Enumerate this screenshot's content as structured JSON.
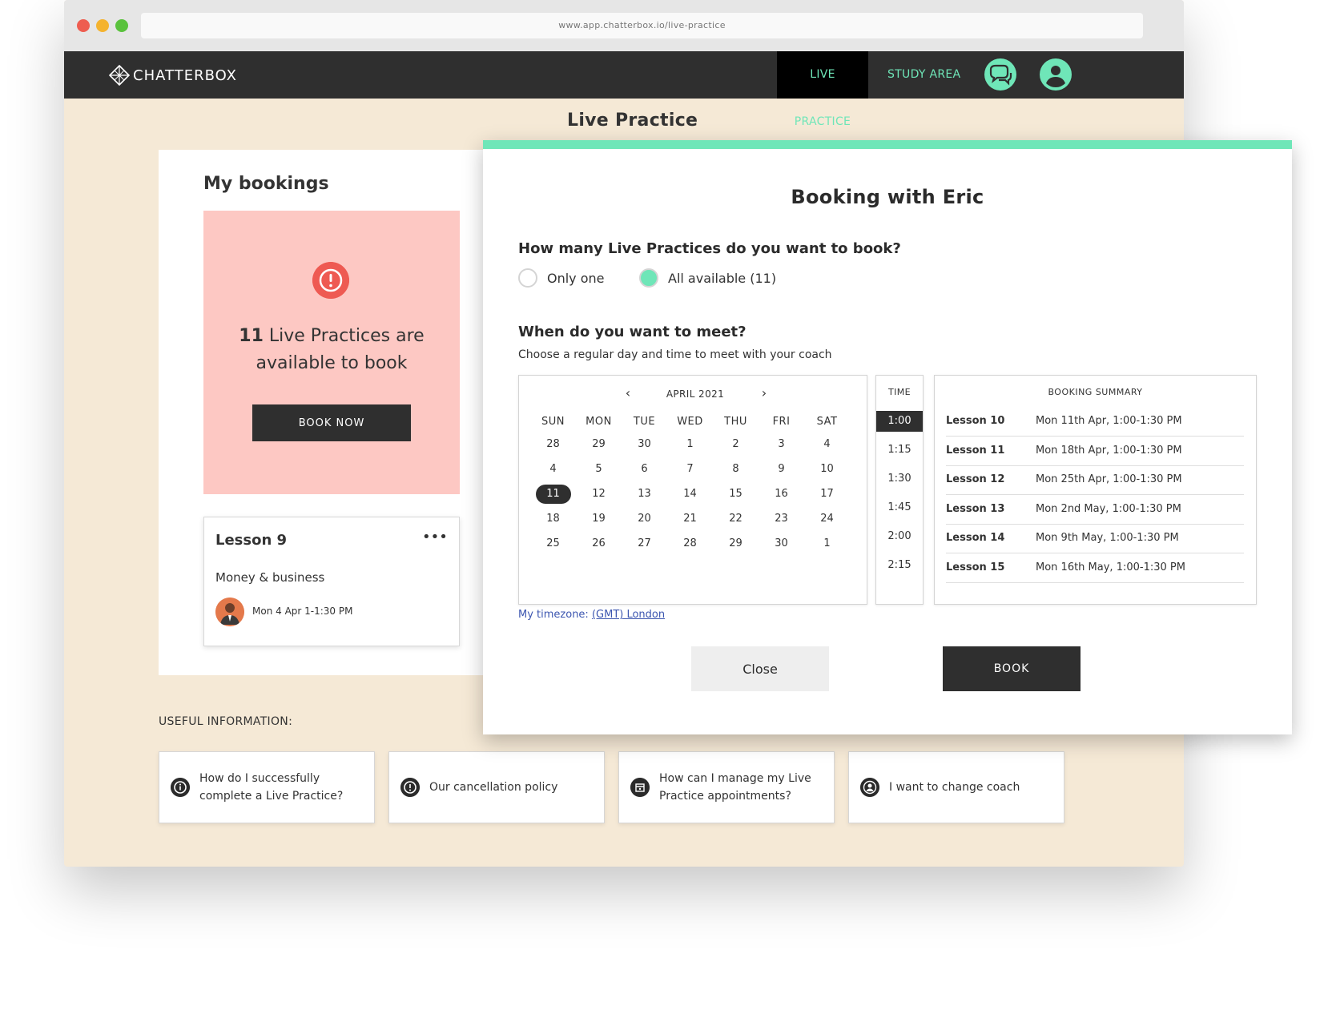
{
  "browser": {
    "url": "www.app.chatterbox.io/live-practice"
  },
  "nav": {
    "logo": "CHATTERBOX",
    "live_practice": "LIVE PRACTICE",
    "study_area": "STUDY AREA",
    "accent": "#6fe6b8"
  },
  "page": {
    "title": "Live Practice"
  },
  "bookings": {
    "title": "My bookings",
    "alert_count": "11",
    "alert_text": "Live Practices are available to book",
    "book_now": "BOOK NOW",
    "lesson": {
      "title": "Lesson 9",
      "topic": "Money & business",
      "date": "Mon 4 Apr 1-1:30 PM"
    }
  },
  "useful": {
    "label": "USEFUL INFORMATION:",
    "cards": [
      {
        "text": "How do I successfully complete a Live Practice?",
        "icon": "info-icon"
      },
      {
        "text": "Our cancellation policy",
        "icon": "alert-icon"
      },
      {
        "text": "How can I manage my Live Practice appointments?",
        "icon": "calendar-icon"
      },
      {
        "text": "I want to change coach",
        "icon": "user-icon"
      }
    ]
  },
  "modal": {
    "title": "Booking with Eric",
    "question_count": "How many Live Practices do you want to book?",
    "option_one": "Only one",
    "option_all": "All available (11)",
    "question_when": "When do you want to meet?",
    "subtitle": "Choose a regular day and time to meet with your coach",
    "calendar": {
      "month": "APRIL 2021",
      "days": [
        "SUN",
        "MON",
        "TUE",
        "WED",
        "THU",
        "FRI",
        "SAT"
      ],
      "weeks": [
        [
          "28",
          "29",
          "30",
          "1",
          "2",
          "3",
          "4"
        ],
        [
          "4",
          "5",
          "6",
          "7",
          "8",
          "9",
          "10"
        ],
        [
          "11",
          "12",
          "13",
          "14",
          "15",
          "16",
          "17"
        ],
        [
          "18",
          "19",
          "20",
          "21",
          "22",
          "23",
          "24"
        ],
        [
          "25",
          "26",
          "27",
          "28",
          "29",
          "30",
          "1"
        ]
      ],
      "selected": "11"
    },
    "time": {
      "header": "TIME",
      "slots": [
        "1:00",
        "1:15",
        "1:30",
        "1:45",
        "2:00",
        "2:15"
      ],
      "selected": "1:00"
    },
    "summary": {
      "header": "BOOKING SUMMARY",
      "rows": [
        {
          "lesson": "Lesson 10",
          "date": "Mon 11th Apr, 1:00-1:30 PM"
        },
        {
          "lesson": "Lesson 11",
          "date": "Mon 18th Apr, 1:00-1:30 PM"
        },
        {
          "lesson": "Lesson 12",
          "date": "Mon 25th Apr, 1:00-1:30 PM"
        },
        {
          "lesson": "Lesson 13",
          "date": "Mon 2nd May, 1:00-1:30 PM"
        },
        {
          "lesson": "Lesson 14",
          "date": "Mon 9th May, 1:00-1:30 PM"
        },
        {
          "lesson": "Lesson 15",
          "date": "Mon 16th May, 1:00-1:30 PM"
        }
      ]
    },
    "timezone_label": "My timezone:",
    "timezone_value": "(GMT) London",
    "close": "Close",
    "book": "BOOK"
  }
}
